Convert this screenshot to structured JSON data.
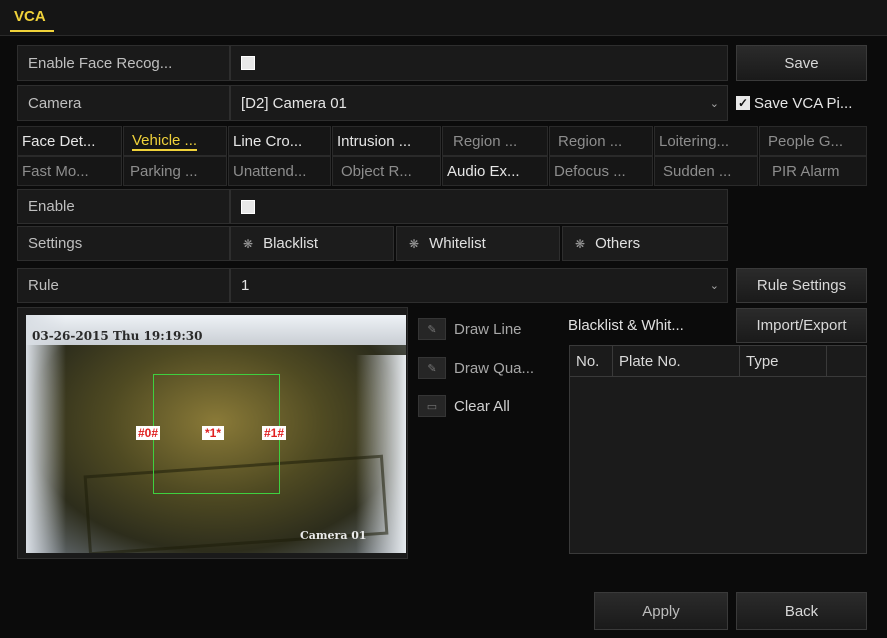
{
  "header": {
    "title": "VCA"
  },
  "face_recog": {
    "label": "Enable Face Recog..."
  },
  "camera": {
    "label": "Camera",
    "value": "[D2] Camera 01",
    "save_vca_label": "Save VCA Pi..."
  },
  "buttons": {
    "save": "Save",
    "rule_settings": "Rule Settings",
    "import_export": "Import/Export",
    "apply": "Apply",
    "back": "Back"
  },
  "tabs_row1": [
    {
      "label": "Face Det..."
    },
    {
      "label": "Vehicle ..."
    },
    {
      "label": "Line Cro..."
    },
    {
      "label": "Intrusion ..."
    },
    {
      "label": "Region ..."
    },
    {
      "label": "Region ..."
    },
    {
      "label": "Loitering..."
    },
    {
      "label": "People G..."
    }
  ],
  "tabs_row2": [
    {
      "label": "Fast Mo..."
    },
    {
      "label": "Parking ..."
    },
    {
      "label": "Unattend..."
    },
    {
      "label": "Object R..."
    },
    {
      "label": "Audio Ex..."
    },
    {
      "label": "Defocus ..."
    },
    {
      "label": "Sudden ..."
    },
    {
      "label": "PIR Alarm"
    }
  ],
  "enable": {
    "label": "Enable"
  },
  "settings": {
    "label": "Settings",
    "options": [
      "Blacklist",
      "Whitelist",
      "Others"
    ]
  },
  "rule": {
    "label": "Rule",
    "value": "1"
  },
  "preview": {
    "timestamp": "03-26-2015 Thu 19:19:30",
    "camera_name": "Camera 01",
    "marker_left": "#0#",
    "marker_center": "*1*",
    "marker_right": "#1#"
  },
  "draw_tools": {
    "draw_line": "Draw Line",
    "draw_quad": "Draw Qua...",
    "clear_all": "Clear All"
  },
  "list": {
    "title": "Blacklist & Whit...",
    "columns": [
      "No.",
      "Plate No.",
      "Type"
    ]
  },
  "colors": {
    "accent": "#f0d23a",
    "detection_box": "#3fcf3f",
    "marker": "#e02020"
  }
}
